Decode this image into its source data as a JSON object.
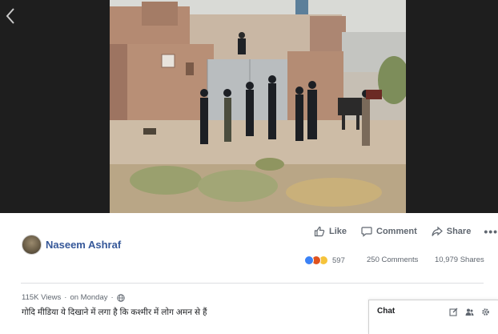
{
  "post": {
    "author": "Naseem Ashraf",
    "actions": {
      "like": "Like",
      "comment": "Comment",
      "share": "Share",
      "more": "•••"
    },
    "reactions_count": "597",
    "comments": "250 Comments",
    "shares": "10,979 Shares",
    "views": "115K Views",
    "separator": "·",
    "date": "on Monday",
    "caption": "गोदि मीडिया ये दिखाने में लगा है कि कश्मीर में लोग अमन से हैं"
  },
  "chat": {
    "label": "Chat"
  },
  "icons": {
    "back": "chevron-left-icon",
    "like": "thumbs-up-icon",
    "comment": "speech-bubble-icon",
    "share": "share-arrow-icon",
    "privacy": "globe-icon",
    "compose": "compose-icon",
    "contacts": "people-icon",
    "settings": "gear-icon"
  },
  "colors": {
    "link": "#365899",
    "video_bg": "#1e1e1e",
    "text_secondary": "#606770"
  }
}
